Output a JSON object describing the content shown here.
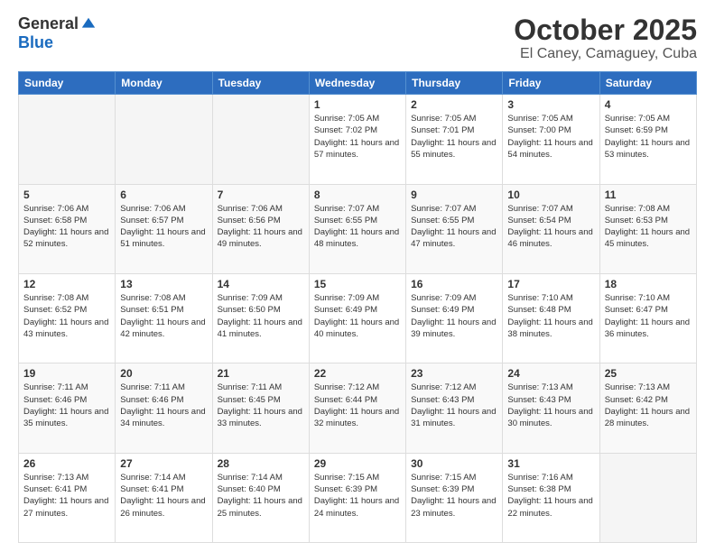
{
  "header": {
    "logo_general": "General",
    "logo_blue": "Blue",
    "month_title": "October 2025",
    "location": "El Caney, Camaguey, Cuba"
  },
  "days_of_week": [
    "Sunday",
    "Monday",
    "Tuesday",
    "Wednesday",
    "Thursday",
    "Friday",
    "Saturday"
  ],
  "weeks": [
    [
      {
        "day": "",
        "sunrise": "",
        "sunset": "",
        "daylight": ""
      },
      {
        "day": "",
        "sunrise": "",
        "sunset": "",
        "daylight": ""
      },
      {
        "day": "",
        "sunrise": "",
        "sunset": "",
        "daylight": ""
      },
      {
        "day": "1",
        "sunrise": "Sunrise: 7:05 AM",
        "sunset": "Sunset: 7:02 PM",
        "daylight": "Daylight: 11 hours and 57 minutes."
      },
      {
        "day": "2",
        "sunrise": "Sunrise: 7:05 AM",
        "sunset": "Sunset: 7:01 PM",
        "daylight": "Daylight: 11 hours and 55 minutes."
      },
      {
        "day": "3",
        "sunrise": "Sunrise: 7:05 AM",
        "sunset": "Sunset: 7:00 PM",
        "daylight": "Daylight: 11 hours and 54 minutes."
      },
      {
        "day": "4",
        "sunrise": "Sunrise: 7:05 AM",
        "sunset": "Sunset: 6:59 PM",
        "daylight": "Daylight: 11 hours and 53 minutes."
      }
    ],
    [
      {
        "day": "5",
        "sunrise": "Sunrise: 7:06 AM",
        "sunset": "Sunset: 6:58 PM",
        "daylight": "Daylight: 11 hours and 52 minutes."
      },
      {
        "day": "6",
        "sunrise": "Sunrise: 7:06 AM",
        "sunset": "Sunset: 6:57 PM",
        "daylight": "Daylight: 11 hours and 51 minutes."
      },
      {
        "day": "7",
        "sunrise": "Sunrise: 7:06 AM",
        "sunset": "Sunset: 6:56 PM",
        "daylight": "Daylight: 11 hours and 49 minutes."
      },
      {
        "day": "8",
        "sunrise": "Sunrise: 7:07 AM",
        "sunset": "Sunset: 6:55 PM",
        "daylight": "Daylight: 11 hours and 48 minutes."
      },
      {
        "day": "9",
        "sunrise": "Sunrise: 7:07 AM",
        "sunset": "Sunset: 6:55 PM",
        "daylight": "Daylight: 11 hours and 47 minutes."
      },
      {
        "day": "10",
        "sunrise": "Sunrise: 7:07 AM",
        "sunset": "Sunset: 6:54 PM",
        "daylight": "Daylight: 11 hours and 46 minutes."
      },
      {
        "day": "11",
        "sunrise": "Sunrise: 7:08 AM",
        "sunset": "Sunset: 6:53 PM",
        "daylight": "Daylight: 11 hours and 45 minutes."
      }
    ],
    [
      {
        "day": "12",
        "sunrise": "Sunrise: 7:08 AM",
        "sunset": "Sunset: 6:52 PM",
        "daylight": "Daylight: 11 hours and 43 minutes."
      },
      {
        "day": "13",
        "sunrise": "Sunrise: 7:08 AM",
        "sunset": "Sunset: 6:51 PM",
        "daylight": "Daylight: 11 hours and 42 minutes."
      },
      {
        "day": "14",
        "sunrise": "Sunrise: 7:09 AM",
        "sunset": "Sunset: 6:50 PM",
        "daylight": "Daylight: 11 hours and 41 minutes."
      },
      {
        "day": "15",
        "sunrise": "Sunrise: 7:09 AM",
        "sunset": "Sunset: 6:49 PM",
        "daylight": "Daylight: 11 hours and 40 minutes."
      },
      {
        "day": "16",
        "sunrise": "Sunrise: 7:09 AM",
        "sunset": "Sunset: 6:49 PM",
        "daylight": "Daylight: 11 hours and 39 minutes."
      },
      {
        "day": "17",
        "sunrise": "Sunrise: 7:10 AM",
        "sunset": "Sunset: 6:48 PM",
        "daylight": "Daylight: 11 hours and 38 minutes."
      },
      {
        "day": "18",
        "sunrise": "Sunrise: 7:10 AM",
        "sunset": "Sunset: 6:47 PM",
        "daylight": "Daylight: 11 hours and 36 minutes."
      }
    ],
    [
      {
        "day": "19",
        "sunrise": "Sunrise: 7:11 AM",
        "sunset": "Sunset: 6:46 PM",
        "daylight": "Daylight: 11 hours and 35 minutes."
      },
      {
        "day": "20",
        "sunrise": "Sunrise: 7:11 AM",
        "sunset": "Sunset: 6:46 PM",
        "daylight": "Daylight: 11 hours and 34 minutes."
      },
      {
        "day": "21",
        "sunrise": "Sunrise: 7:11 AM",
        "sunset": "Sunset: 6:45 PM",
        "daylight": "Daylight: 11 hours and 33 minutes."
      },
      {
        "day": "22",
        "sunrise": "Sunrise: 7:12 AM",
        "sunset": "Sunset: 6:44 PM",
        "daylight": "Daylight: 11 hours and 32 minutes."
      },
      {
        "day": "23",
        "sunrise": "Sunrise: 7:12 AM",
        "sunset": "Sunset: 6:43 PM",
        "daylight": "Daylight: 11 hours and 31 minutes."
      },
      {
        "day": "24",
        "sunrise": "Sunrise: 7:13 AM",
        "sunset": "Sunset: 6:43 PM",
        "daylight": "Daylight: 11 hours and 30 minutes."
      },
      {
        "day": "25",
        "sunrise": "Sunrise: 7:13 AM",
        "sunset": "Sunset: 6:42 PM",
        "daylight": "Daylight: 11 hours and 28 minutes."
      }
    ],
    [
      {
        "day": "26",
        "sunrise": "Sunrise: 7:13 AM",
        "sunset": "Sunset: 6:41 PM",
        "daylight": "Daylight: 11 hours and 27 minutes."
      },
      {
        "day": "27",
        "sunrise": "Sunrise: 7:14 AM",
        "sunset": "Sunset: 6:41 PM",
        "daylight": "Daylight: 11 hours and 26 minutes."
      },
      {
        "day": "28",
        "sunrise": "Sunrise: 7:14 AM",
        "sunset": "Sunset: 6:40 PM",
        "daylight": "Daylight: 11 hours and 25 minutes."
      },
      {
        "day": "29",
        "sunrise": "Sunrise: 7:15 AM",
        "sunset": "Sunset: 6:39 PM",
        "daylight": "Daylight: 11 hours and 24 minutes."
      },
      {
        "day": "30",
        "sunrise": "Sunrise: 7:15 AM",
        "sunset": "Sunset: 6:39 PM",
        "daylight": "Daylight: 11 hours and 23 minutes."
      },
      {
        "day": "31",
        "sunrise": "Sunrise: 7:16 AM",
        "sunset": "Sunset: 6:38 PM",
        "daylight": "Daylight: 11 hours and 22 minutes."
      },
      {
        "day": "",
        "sunrise": "",
        "sunset": "",
        "daylight": ""
      }
    ]
  ]
}
